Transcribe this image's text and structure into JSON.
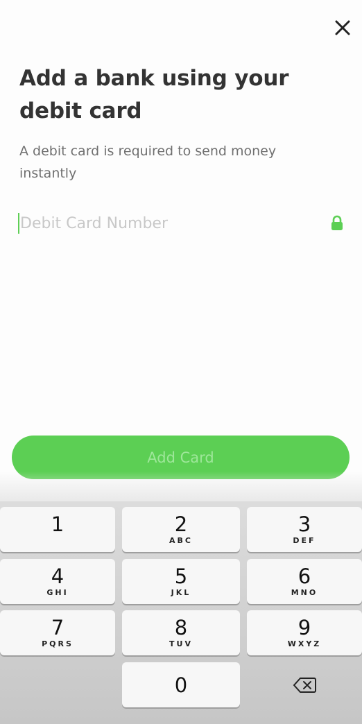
{
  "header": {
    "close_icon": "close-icon",
    "title": "Add a bank using your debit card",
    "subtitle": "A debit card is required to send money instantly"
  },
  "card_field": {
    "placeholder": "Debit Card Number",
    "value": "",
    "lock_icon": "lock-icon"
  },
  "actions": {
    "add_card_label": "Add Card"
  },
  "keypad": {
    "keys": [
      {
        "num": "1",
        "letters": ""
      },
      {
        "num": "2",
        "letters": "ABC"
      },
      {
        "num": "3",
        "letters": "DEF"
      },
      {
        "num": "4",
        "letters": "GHI"
      },
      {
        "num": "5",
        "letters": "JKL"
      },
      {
        "num": "6",
        "letters": "MNO"
      },
      {
        "num": "7",
        "letters": "PQRS"
      },
      {
        "num": "8",
        "letters": "TUV"
      },
      {
        "num": "9",
        "letters": "WXYZ"
      },
      {
        "num": "0",
        "letters": ""
      }
    ],
    "delete_icon": "backspace-icon"
  },
  "colors": {
    "accent": "#5ccf54",
    "title_text": "#333333",
    "subtitle_text": "#707070"
  }
}
